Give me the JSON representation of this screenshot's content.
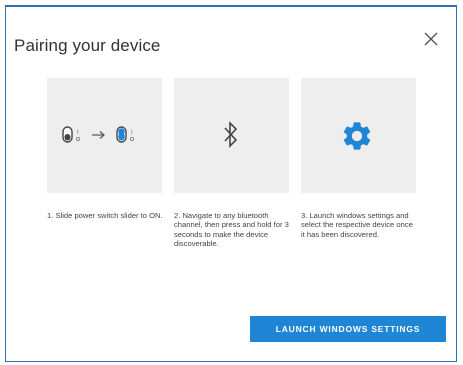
{
  "dialog": {
    "title": "Pairing your device",
    "close_icon": "close-icon"
  },
  "steps": [
    {
      "icon": "slider-switch-icon",
      "arrow": "→",
      "description": "1. Slide power switch slider to ON."
    },
    {
      "icon": "bluetooth-icon",
      "description": "2. Navigate to any bluetooth channel, then press and hold for 3 seconds to make the device discoverable."
    },
    {
      "icon": "gear-icon",
      "description": "3. Launch windows settings and select the respective device once it has been discovered."
    }
  ],
  "actions": {
    "launch_label": "LAUNCH WINDOWS SETTINGS"
  },
  "colors": {
    "accent": "#1f86d6",
    "border": "#2f6fb3",
    "card_bg": "#eeeeee"
  }
}
